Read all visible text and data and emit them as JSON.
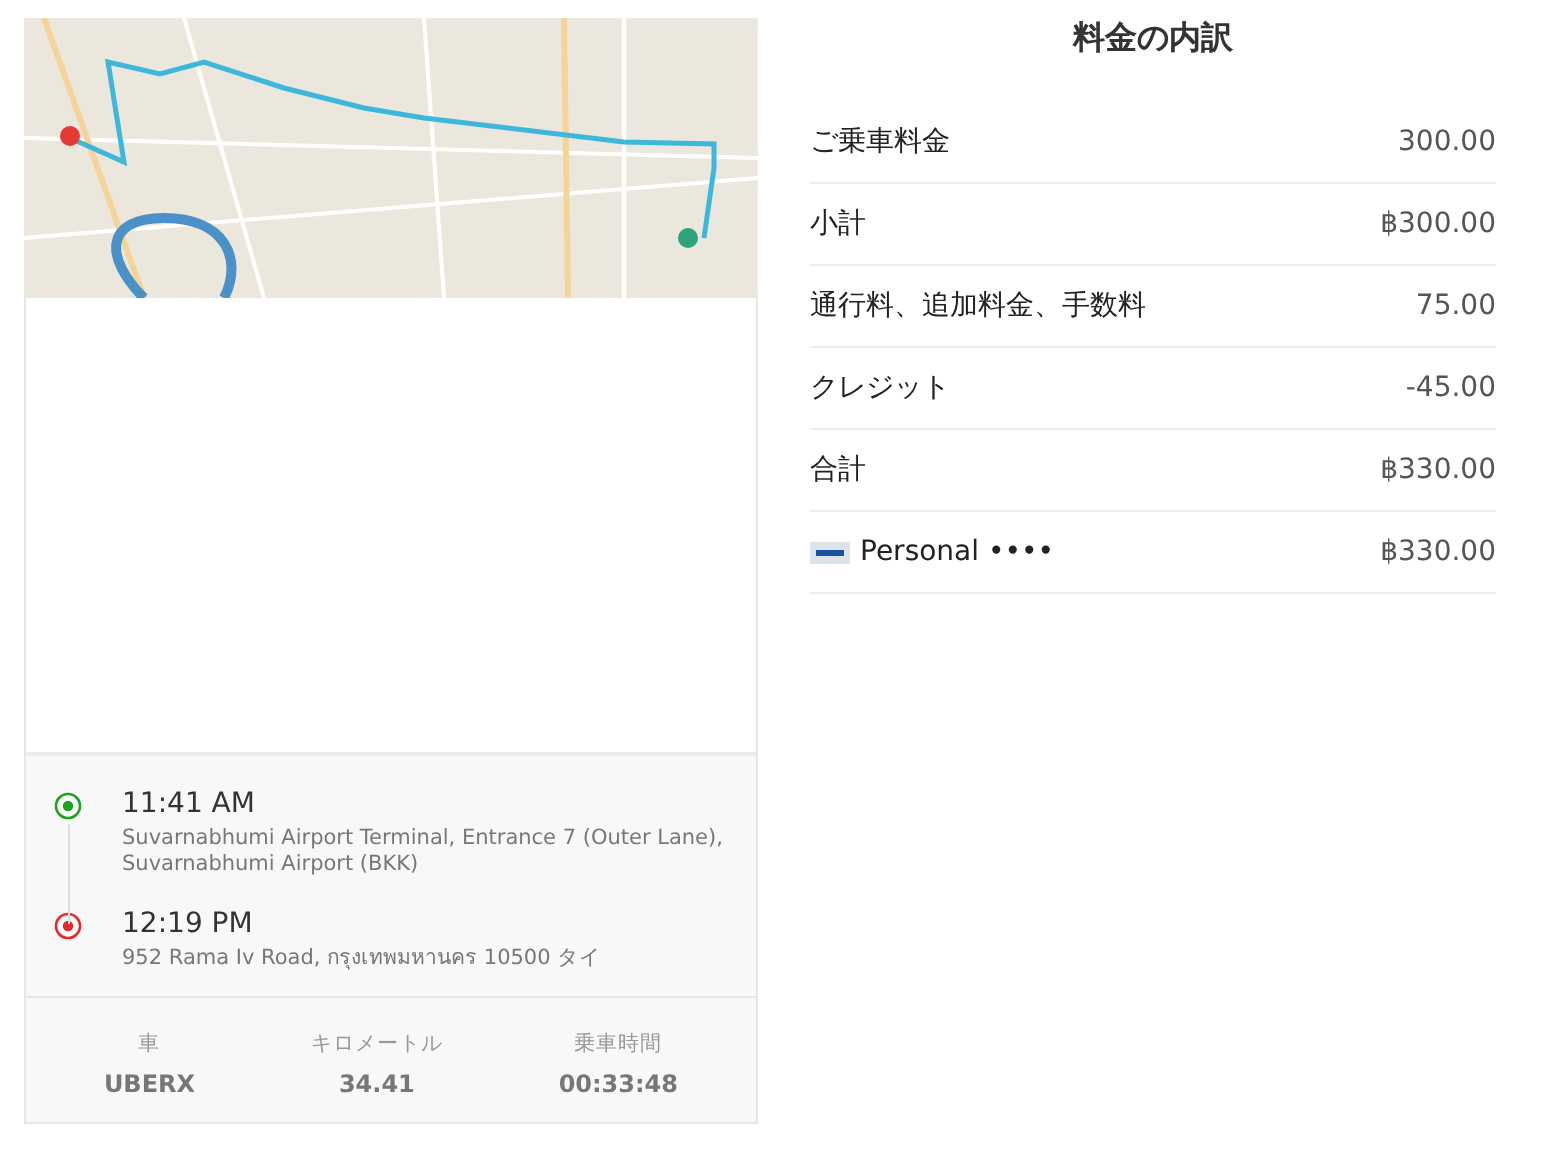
{
  "trip": {
    "stops": [
      {
        "kind": "pickup",
        "time": "11:41 AM",
        "address": "Suvarnabhumi Airport Terminal, Entrance 7 (Outer Lane), Suvarnabhumi Airport (BKK)"
      },
      {
        "kind": "dropoff",
        "time": "12:19 PM",
        "address": "952 Rama Iv Road, กรุงเทพมหานคร 10500 タイ"
      }
    ],
    "stats": [
      {
        "label": "車",
        "value": "UBERX"
      },
      {
        "label": "キロメートル",
        "value": "34.41"
      },
      {
        "label": "乗車時間",
        "value": "00:33:48"
      }
    ]
  },
  "fare": {
    "title": "料金の内訳",
    "rows": [
      {
        "kind": "line",
        "label": "ご乗車料金",
        "amount": "300.00"
      },
      {
        "kind": "line",
        "label": "小計",
        "amount": "฿300.00"
      },
      {
        "kind": "line",
        "label": "通行料、追加料金、手数料",
        "amount": "75.00"
      },
      {
        "kind": "line",
        "label": "クレジット",
        "amount": "-45.00"
      },
      {
        "kind": "line",
        "label": "合計",
        "amount": "฿330.00"
      },
      {
        "kind": "payment",
        "label": "Personal ••••",
        "amount": "฿330.00"
      }
    ]
  }
}
